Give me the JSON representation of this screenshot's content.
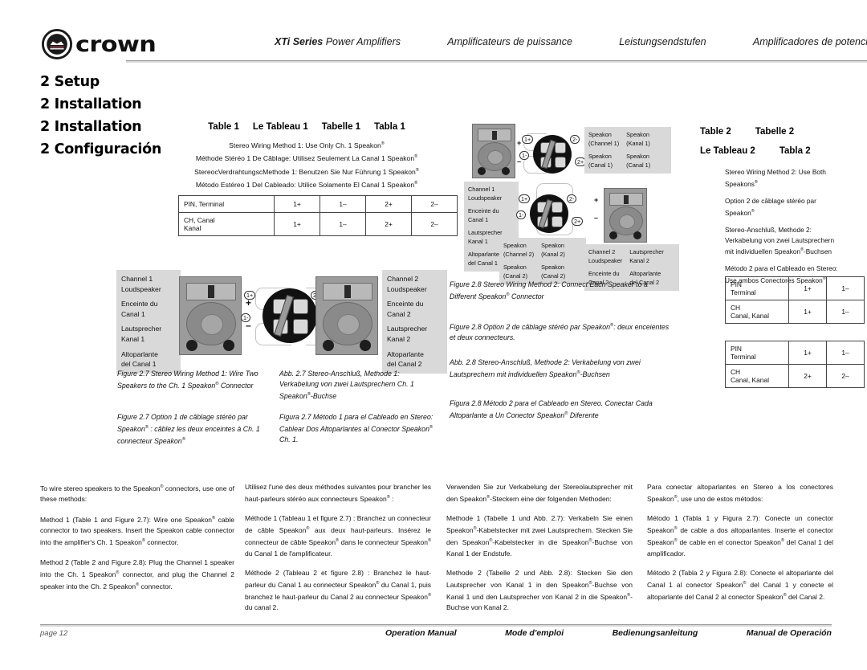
{
  "header": {
    "brand": "crown",
    "titles": [
      {
        "bold": "XTi Series",
        "rest": " Power Amplifiers"
      },
      {
        "bold": "",
        "rest": "Amplificateurs de puissance"
      },
      {
        "bold": "",
        "rest": "Leistungsendstufen"
      },
      {
        "bold": "",
        "rest": "Amplificadores de potencia"
      }
    ]
  },
  "section": {
    "lines": [
      "2 Setup",
      "2 Installation",
      "2 Installation",
      "2 Configuración"
    ]
  },
  "table1": {
    "headings": [
      "Table 1",
      "Le Tableau 1",
      "Tabelle 1",
      "Tabla 1"
    ],
    "subtitles": [
      "Stereo Wiring Method 1: Use Only Ch. 1 Speakon®",
      "Méthode Stéréo 1 De Câblage:  Utilisez Seulement La Canal 1 Speakon®",
      "StereocVerdrahtungscMethode 1: Benutzen Sie Nur Führung 1 Speakon®",
      "Método Estéreo 1 Del Cableado: Utilice Solamente El Canal 1 Speakon®"
    ],
    "rows": [
      {
        "label": "PIN, Terminal",
        "label2": "",
        "values": [
          "1+",
          "1–",
          "2+",
          "2–"
        ]
      },
      {
        "label": "CH, Canal",
        "label2": "Kanal",
        "values": [
          "1+",
          "1–",
          "2+",
          "2–"
        ]
      }
    ]
  },
  "figure27": {
    "left_labels": [
      "Channel 1",
      "Loudspeaker",
      "Enceinte du",
      "Canal 1",
      "Lautsprecher",
      "Kanal 1",
      "Altoparlante",
      "del Canal 1"
    ],
    "right_labels": [
      "Channel 2",
      "Loudspeaker",
      "Enceinte du",
      "Canal 2",
      "Lautsprecher",
      "Kanal 2",
      "Altoparlante",
      "del Canal 2"
    ],
    "pin_markers": [
      "1+",
      "1-",
      "2-",
      "2+"
    ],
    "terminal_left_plus": "+",
    "terminal_left_minus": "–",
    "terminal_right_plus": "+",
    "terminal_right_minus": "–",
    "captions": [
      "Figure 2.7  Stereo Wiring Method 1: Wire Two Speakers to the Ch. 1 Speakon® Connector",
      "Abb. 2.7 Stereo-Anschluß, Methode 1: Verkabelung von zwei Lautsprechern Ch. 1 Speakon®-Buchse",
      "Figure 2.7 Option 1 de câblage stéréo par Speakon® : câblez les deux enceintes à Ch. 1 connecteur Speakon®",
      "Figura 2.7  Método 1 para el Cableado en Stereo: Cablear Dos Altoparlantes al Conector Speakon®  Ch. 1."
    ]
  },
  "figure28": {
    "speakon_ch1": [
      [
        "Speakon",
        "(Channel 1)",
        "Speakon",
        "(Canal 1)"
      ],
      [
        "Speakon",
        "(Kanal 1)",
        "Speakon",
        "(Canal 1)"
      ]
    ],
    "speakon_ch2": [
      [
        "Speakon",
        "(Channel 2)",
        "Speakon",
        "(Canal 2)"
      ],
      [
        "Speakon",
        "(Kanal 2)",
        "Speakon",
        "(Canal 2)"
      ]
    ],
    "ch1_labels": [
      "Channel 1",
      "Loudspeaker",
      "Enceinte du",
      "Canal 1",
      "Lautsprecher",
      "Kanal 1",
      "Altoparlante",
      "del Canal 1"
    ],
    "ch2_labels": [
      [
        "Channel 2",
        "Loudspeaker",
        "Enceinte du",
        "Canal 2"
      ],
      [
        "Lautsprecher",
        "Kanal 2",
        "Altoparlante",
        "del Canal 2"
      ]
    ],
    "pin_markers": [
      "1+",
      "1-",
      "2-",
      "2+"
    ],
    "captions": [
      "Figure 2.8  Stereo Wiring Method 2: Connect Each Speaker to a Different Speakon® Connector",
      "Figure 2.8 Option 2 de câblage stéréo par Speakon®: deux enceientes et deux connecteurs.",
      "Abb. 2.8 Stereo-Anschluß, Methode 2: Verkabelung von zwei Lautsprechern mit individuellen Speakon®-Buchsen",
      "Figura 2.8 Método 2 para el Cableado en Stereo. Conectar Cada Altoparlante a Un Conector Speakon® Diferente"
    ]
  },
  "table2": {
    "headings": [
      [
        "Table 2",
        "Tabelle 2"
      ],
      [
        "Le Tableau 2",
        "Tabla 2"
      ]
    ],
    "subtitles": [
      "Stereo Wiring Method 2: Use Both Speakons®",
      "Option 2 de câblage stéréo par Speakon®",
      "Stereo-Anschluß, Methode 2: Verkabelung von zwei Lautsprechern mit individuellen Speakon®-Buchsen",
      "Método 2 para el Cableado en Stereo: Use ambos Conectores Speakon®"
    ],
    "tableA": [
      {
        "label": "PIN",
        "label2": "Terminal",
        "values": [
          "1+",
          "1–"
        ]
      },
      {
        "label": "CH",
        "label2": "Canal, Kanal",
        "values": [
          "1+",
          "1–"
        ]
      }
    ],
    "tableB": [
      {
        "label": "PIN",
        "label2": "Terminal",
        "values": [
          "1+",
          "1–"
        ]
      },
      {
        "label": "CH",
        "label2": "Canal, Kanal",
        "values": [
          "2+",
          "2–"
        ]
      }
    ]
  },
  "body": {
    "col1": [
      "To wire stereo speakers to the Speakon® connectors, use one of these methods:",
      "Method 1 (Table 1 and Figure 2.7): Wire one Speakon® cable connector to two speakers. Insert the Speakon cable connector into the amplifier's Ch. 1 Speakon® connector.",
      "Method 2 (Table 2 and Figure 2.8): Plug the Channel 1 speaker into the Ch. 1 Speakon® connector, and plug the Channel 2 speaker into the Ch. 2 Speakon® connector."
    ],
    "col2": [
      "Utilisez l'une des deux méthodes suivantes pour brancher les haut-parleurs stéréo aux connecteurs Speakon® :",
      "Méthode 1 (Tableau 1 et figure 2.7) : Branchez un connecteur de câble Speakon® aux deux haut-parleurs. Insérez le connecteur de câble  Speakon® dans le connecteur Speakon® du Canal 1 de l'amplificateur.",
      "Méthode 2 (Tableau 2 et figure 2.8) : Branchez le haut-parleur du Canal 1 au connecteur Speakon® du Canal 1, puis branchez le haut-parleur du Canal 2 au connecteur Speakon® du canal 2."
    ],
    "col3": [
      "Verwenden Sie zur Verkabelung der Stereolautsprecher mit den Speakon®-Steckern eine der folgenden Methoden:",
      "Methode 1 (Tabelle 1 und Abb. 2.7): Verkabeln Sie einen Speakon®-Kabelstecker mit zwei Lautsprechern. Stecken Sie den Speakon®-Kabelstecker in die Speakon®-Buchse von Kanal 1 der Endstufe.",
      "Methode 2 (Tabelle 2 und Abb. 2.8): Stecken Sie den Lautsprecher von Kanal 1 in den Speakon®-Buchse von Kanal 1 und den Lautsprecher von Kanal 2 in die Speakon®-Buchse von Kanal 2."
    ],
    "col4": [
      "Para conectar altoparlantes en Stereo a los conectores Speakon®, use uno de estos métodos:",
      "Método 1 (Tabla 1 y Figura 2.7): Conecte un conector Speakon® de cable a dos altoparlantes. Inserte el conector Speakon® de cable en el conector Speakon® del Canal 1 del amplificador.",
      "Método 2 (Tabla 2 y Figura 2.8): Conecte el altoparlante del Canal 1 al conector Speakon® del Canal 1 y conecte el altoparlante del Canal 2 al conector Speakon® del Canal 2."
    ]
  },
  "footer": {
    "page": "page 12",
    "manuals": [
      "Operation Manual",
      "Mode d'emploi",
      "Bedienungsanleitung",
      "Manual de Operación"
    ]
  }
}
